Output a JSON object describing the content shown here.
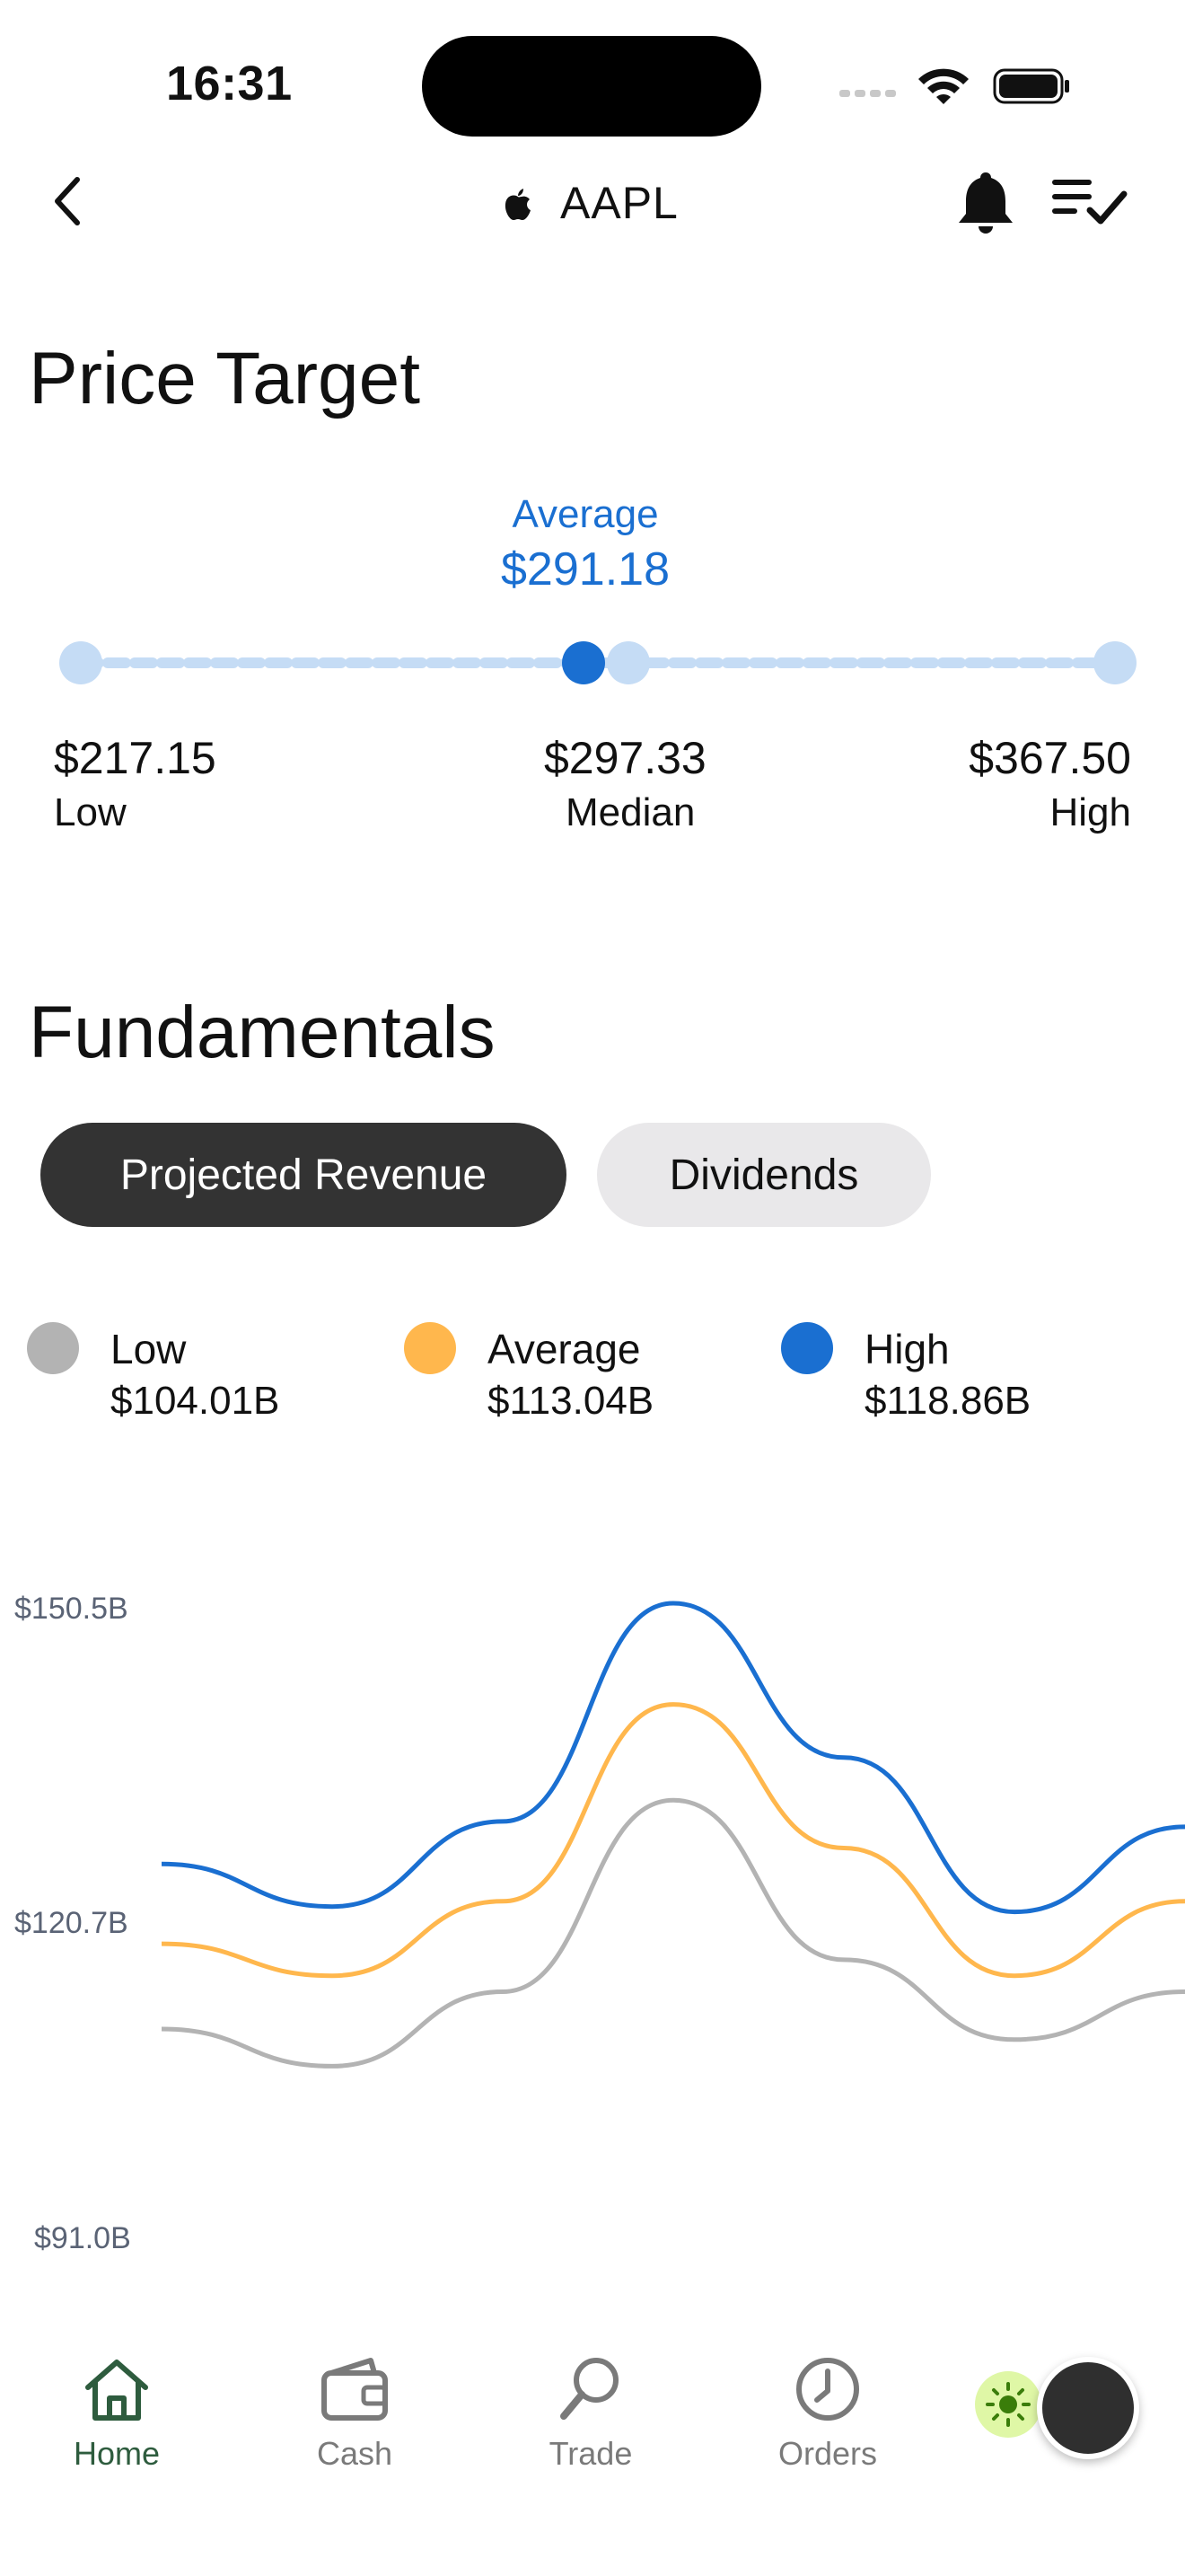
{
  "status_bar": {
    "time": "16:31"
  },
  "header": {
    "ticker": "AAPL",
    "icons": [
      "back-arrow-icon",
      "apple-logo-icon",
      "bell-icon",
      "list-check-icon"
    ]
  },
  "price_target": {
    "title": "Price Target",
    "average_label": "Average",
    "average_value": "$291.18",
    "low_value": "$217.15",
    "low_label": "Low",
    "median_value": "$297.33",
    "median_label": "Median",
    "high_value": "$367.50",
    "high_label": "High",
    "colors": {
      "accent": "#1a6fd1",
      "track": "#c5dcf5"
    }
  },
  "fundamentals": {
    "title": "Fundamentals",
    "tabs": [
      {
        "label": "Projected Revenue",
        "active": true
      },
      {
        "label": "Dividends",
        "active": false
      }
    ],
    "legend": [
      {
        "name": "Low",
        "value": "$104.01B",
        "color": "#b3b3b3"
      },
      {
        "name": "Average",
        "value": "$113.04B",
        "color": "#ffb74d"
      },
      {
        "name": "High",
        "value": "$118.86B",
        "color": "#1a6fd1"
      }
    ],
    "y_ticks": [
      "$150.5B",
      "$120.7B",
      "$91.0B"
    ]
  },
  "chart_data": {
    "type": "line",
    "title": "",
    "xlabel": "",
    "ylabel": "",
    "ylim": [
      91.0,
      150.5
    ],
    "y_ticks": [
      150.5,
      120.7,
      91.0
    ],
    "grid": false,
    "legend": "top",
    "x": [
      0,
      1,
      2,
      3,
      4,
      5,
      6
    ],
    "series": [
      {
        "name": "Low",
        "color": "#b3b3b3",
        "values": [
          110.5,
          107.0,
          114.0,
          132.0,
          117.0,
          109.5,
          114.0
        ]
      },
      {
        "name": "Average",
        "color": "#ffb74d",
        "values": [
          118.5,
          115.5,
          122.5,
          141.0,
          127.5,
          115.5,
          122.5
        ]
      },
      {
        "name": "High",
        "color": "#1a6fd1",
        "values": [
          126.0,
          122.0,
          130.0,
          150.5,
          136.0,
          121.5,
          129.5
        ]
      }
    ]
  },
  "tabbar": {
    "items": [
      {
        "label": "Home",
        "active": true
      },
      {
        "label": "Cash",
        "active": false
      },
      {
        "label": "Trade",
        "active": false
      },
      {
        "label": "Orders",
        "active": false
      }
    ],
    "active_color": "#2e5c3e",
    "inactive_color": "#7a7a7a"
  }
}
